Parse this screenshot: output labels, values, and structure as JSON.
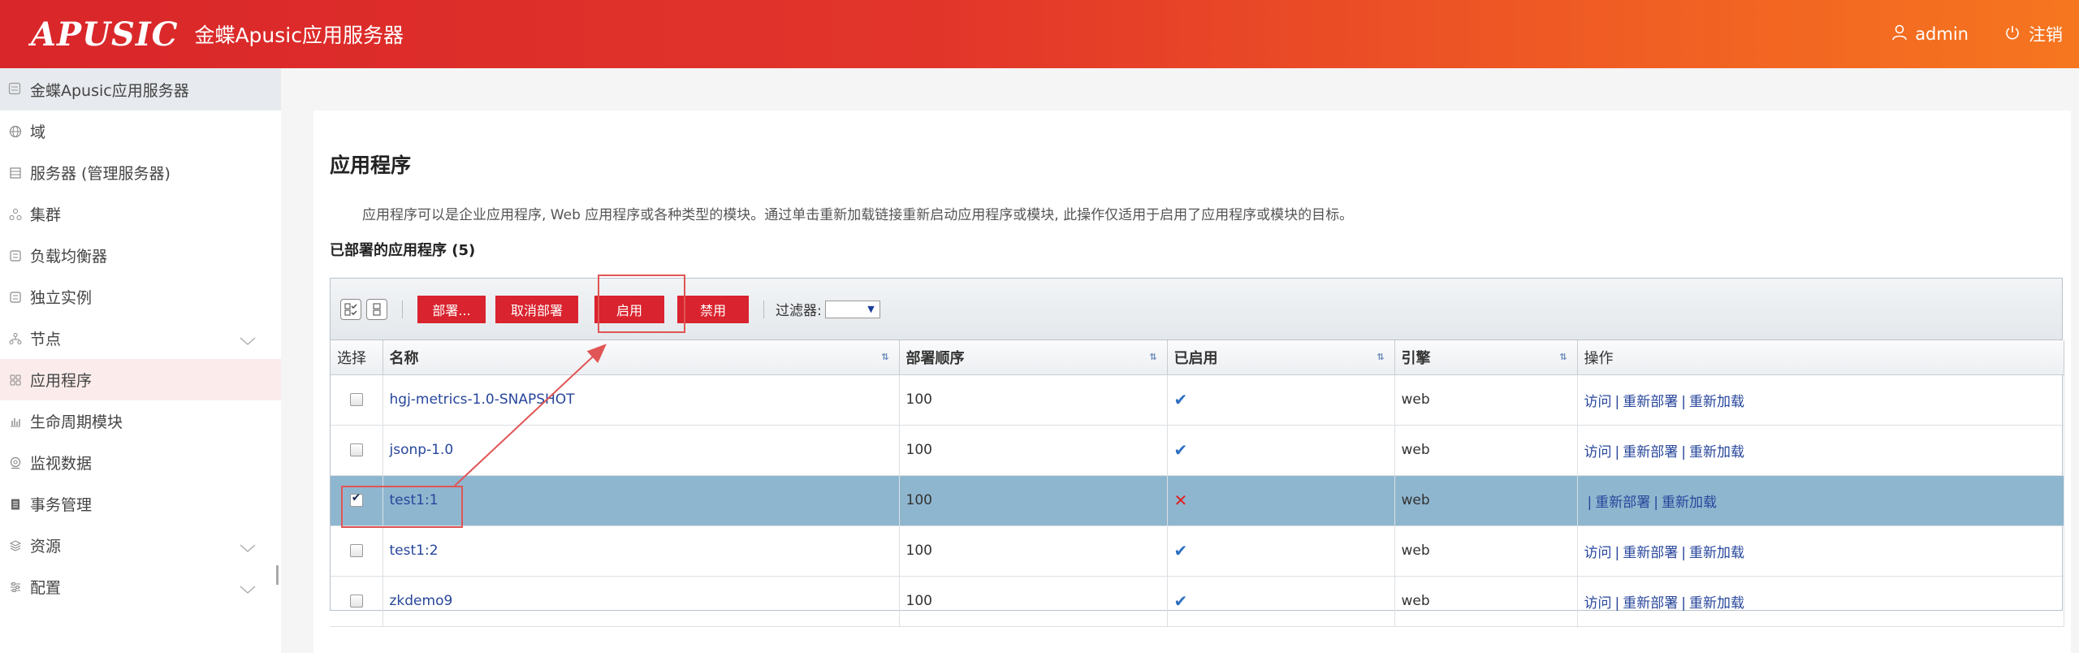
{
  "header": {
    "logo": "APUSIC",
    "title": "金蝶Apusic应用服务器",
    "user": "admin",
    "logout": "注销"
  },
  "sidebar": {
    "top": "金蝶Apusic应用服务器",
    "items": [
      {
        "label": "域",
        "icon": "globe-icon"
      },
      {
        "label": "服务器 (管理服务器)",
        "icon": "server-icon"
      },
      {
        "label": "集群",
        "icon": "cluster-icon"
      },
      {
        "label": "负载均衡器",
        "icon": "loadbalancer-icon"
      },
      {
        "label": "独立实例",
        "icon": "instance-icon"
      },
      {
        "label": "节点",
        "icon": "nodes-icon"
      },
      {
        "label": "应用程序",
        "icon": "apps-icon"
      },
      {
        "label": "生命周期模块",
        "icon": "chart-icon"
      },
      {
        "label": "监视数据",
        "icon": "monitor-icon"
      },
      {
        "label": "事务管理",
        "icon": "transaction-icon"
      },
      {
        "label": "资源",
        "icon": "resource-icon"
      },
      {
        "label": "配置",
        "icon": "config-icon"
      }
    ]
  },
  "main": {
    "title": "应用程序",
    "description": "应用程序可以是企业应用程序, Web 应用程序或各种类型的模块。通过单击重新加载链接重新启动应用程序或模块, 此操作仅适用于启用了应用程序或模块的目标。",
    "section_title": "已部署的应用程序 (5)"
  },
  "toolbar": {
    "deploy": "部署...",
    "undeploy": "取消部署",
    "enable": "启用",
    "disable": "禁用",
    "filter_label": "过滤器:"
  },
  "table": {
    "headers": {
      "select": "选择",
      "name": "名称",
      "order": "部署顺序",
      "enabled": "已启用",
      "engine": "引擎",
      "actions": "操作"
    },
    "rows": [
      {
        "name": "hgj-metrics-1.0-SNAPSHOT",
        "order": "100",
        "engine": "web",
        "visit": "访问",
        "redeploy": "重新部署",
        "reload": "重新加载"
      },
      {
        "name": "jsonp-1.0",
        "order": "100",
        "engine": "web",
        "visit": "访问",
        "redeploy": "重新部署",
        "reload": "重新加载"
      },
      {
        "name": "test1:1",
        "order": "100",
        "engine": "web",
        "redeploy": "重新部署",
        "reload": "重新加载"
      },
      {
        "name": "test1:2",
        "order": "100",
        "engine": "web",
        "visit": "访问",
        "redeploy": "重新部署",
        "reload": "重新加载"
      },
      {
        "name": "zkdemo9",
        "order": "100",
        "engine": "web",
        "visit": "访问",
        "redeploy": "重新部署",
        "reload": "重新加载"
      }
    ]
  },
  "colors": {
    "brand_red": "#d9262a",
    "brand_orange": "#f6761f",
    "button_red": "#d9232e",
    "selected_row": "#8fb6cf",
    "link": "#27469b",
    "annotation": "#e05555"
  }
}
